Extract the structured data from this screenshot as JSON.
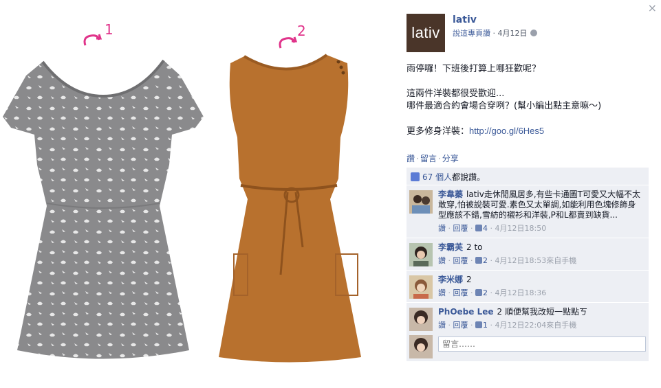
{
  "photo": {
    "label_1": "1",
    "label_2": "2"
  },
  "close_glyph": "×",
  "page": {
    "logo_text": "lativ",
    "name": "lativ",
    "meta_link": "說這專頁讚",
    "meta_sep": " · ",
    "date": "4月12日",
    "globe_icon": "globe-icon"
  },
  "post": {
    "line1": "雨停囉！下班後打算上哪狂歡呢？",
    "line2": "這兩件洋裝都很受歡迎...",
    "line3": "哪件最適合約會場合穿咧？(幫小編出點主意嘛～)",
    "line4_prefix": "更多修身洋裝：",
    "line4_link": "http://goo.gl/6Hes5"
  },
  "actions": {
    "like": "讚",
    "comment": "留言",
    "share": "分享",
    "dot": "·"
  },
  "likes": {
    "count": "67 個人",
    "suffix": "都說讚。"
  },
  "comments": [
    {
      "name": "李韋蓁",
      "text": "lativ走休閒風居多,有些卡通圖T可愛又大幅不太敢穿,怕被說裝可愛.素色又太單調,如能利用色塊修飾身型應該不錯,雪紡的襯衫和洋裝,P和L都賣到缺貨...",
      "like": "讚",
      "reply": "回覆",
      "likes": "4",
      "time": "4月12日18:50"
    },
    {
      "name": "李霸芙",
      "text": "2 to",
      "like": "讚",
      "reply": "回覆",
      "likes": "2",
      "time": "4月12日18:53來自手機"
    },
    {
      "name": "李米娜",
      "text": "2",
      "like": "讚",
      "reply": "回覆",
      "likes": "2",
      "time": "4月12日18:36"
    },
    {
      "name": "PhOebe Lee",
      "text": "2 順便幫我改短一點點ㄎ",
      "like": "讚",
      "reply": "回覆",
      "likes": "1",
      "time": "4月12日22:04來自手機"
    }
  ],
  "compose": {
    "placeholder": "留言……"
  },
  "colors": {
    "brand_blue": "#3b5998",
    "ufi_bg": "#edeff4",
    "logo_bg": "#4a3529",
    "annotation_pink": "#e0338a"
  }
}
